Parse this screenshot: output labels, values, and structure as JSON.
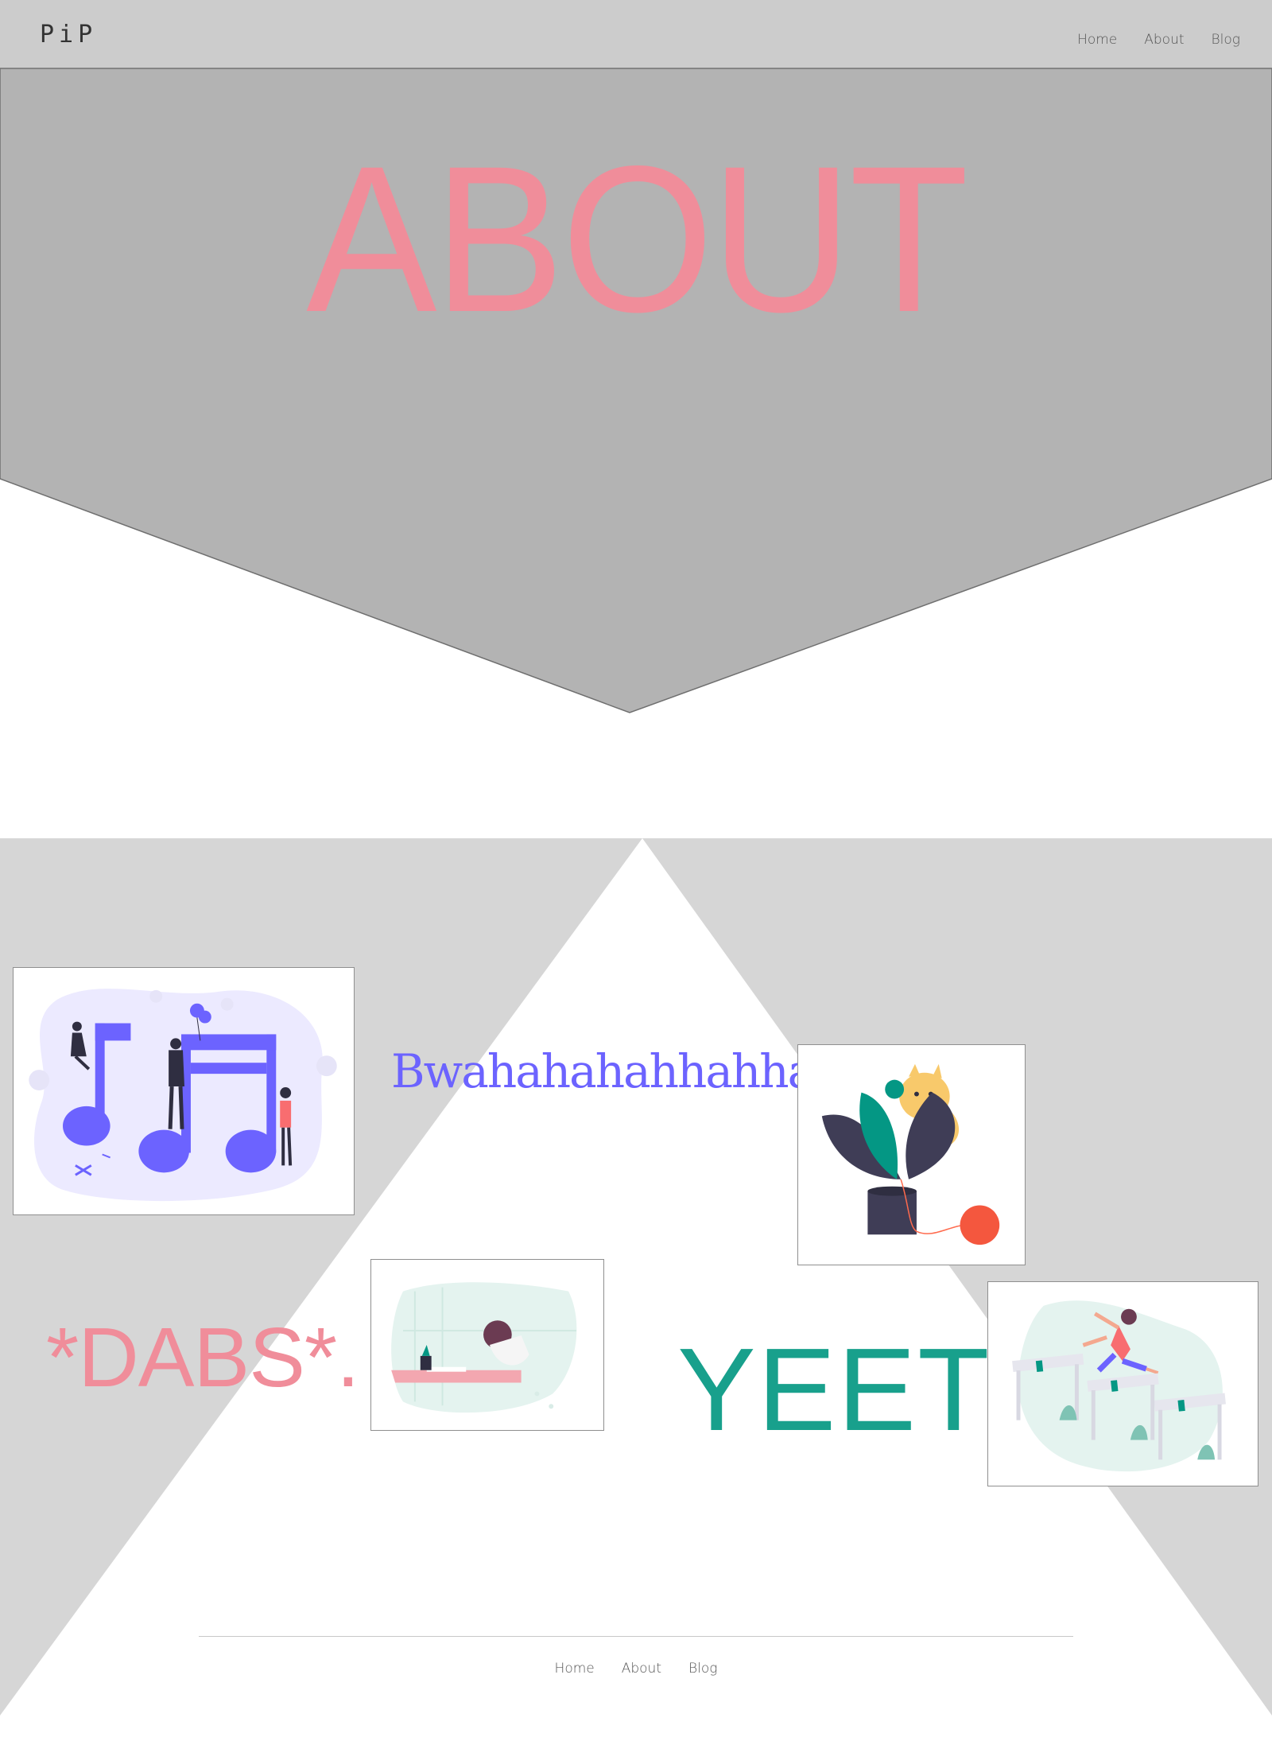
{
  "nav": {
    "brand": "PiP",
    "links": [
      "Home",
      "About",
      "Blog"
    ]
  },
  "hero": {
    "title": "ABOUT"
  },
  "words": {
    "bwaha": "Bwahahahahhahhah",
    "dabs": "*DABS*.",
    "yeet": "YEET"
  },
  "footer": {
    "links": [
      "Home",
      "About",
      "Blog"
    ]
  },
  "colors": {
    "navbar": "#cccccc",
    "hero_panel": "#b3b3b3",
    "section_bg": "#d6d6d6",
    "pink": "#f08d9a",
    "purple": "#6c63ff",
    "teal": "#18a08c"
  },
  "illustrations": [
    "music-notes-illustration",
    "plant-cat-illustration",
    "reading-illustration",
    "hurdles-illustration"
  ]
}
